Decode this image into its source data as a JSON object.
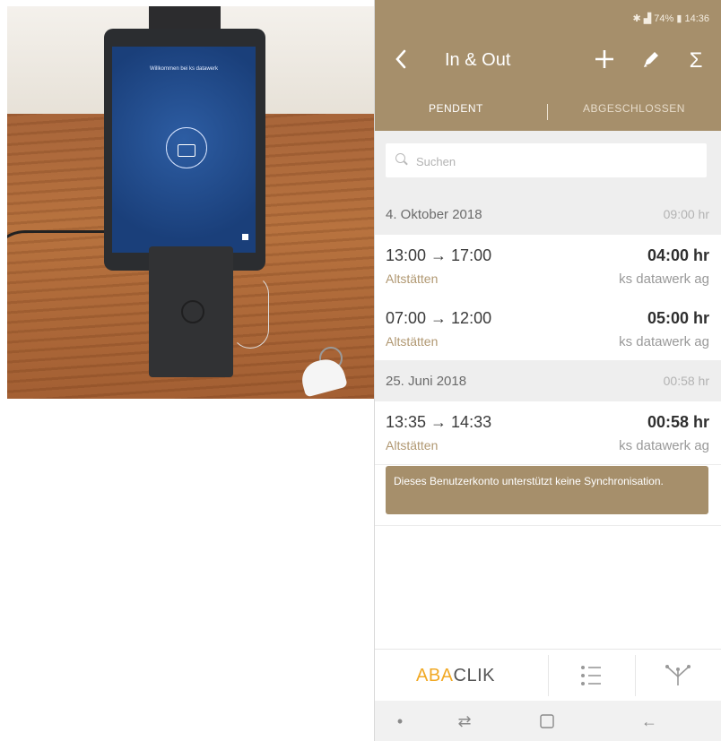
{
  "photo": {
    "screen_greeting": "Willkommen bei ks datawerk"
  },
  "status_bar": {
    "battery": "74%",
    "time": "14:36"
  },
  "app_bar": {
    "back_icon": "back-chevron-icon",
    "title": "In & Out",
    "actions": [
      {
        "name": "add",
        "icon": "plus-icon",
        "glyph": "+"
      },
      {
        "name": "edit",
        "icon": "pencil-icon",
        "glyph": "✎"
      },
      {
        "name": "sum",
        "icon": "sigma-icon",
        "glyph": "Σ"
      }
    ]
  },
  "tabs": [
    {
      "label": "PENDENT",
      "selected": true
    },
    {
      "label": "ABGESCHLOSSEN",
      "selected": false
    }
  ],
  "search": {
    "placeholder": "Suchen"
  },
  "groups": [
    {
      "date": "4. Oktober 2018",
      "total": "09:00 hr",
      "entries": [
        {
          "time": "13:00 → 17:00",
          "duration": "04:00 hr",
          "location": "Altstätten",
          "organization": "ks datawerk ag"
        },
        {
          "time": "07:00 → 12:00",
          "duration": "05:00 hr",
          "location": "Altstätten",
          "organization": "ks datawerk ag"
        }
      ]
    },
    {
      "date": "25. Juni 2018",
      "total": "00:58 hr",
      "entries": [
        {
          "time": "13:35 → 14:33",
          "duration": "00:58 hr",
          "location": "Altstätten",
          "organization": "ks datawerk ag"
        }
      ]
    }
  ],
  "sync_notice": "Dieses Benutzerkonto unterstützt keine Synchronisation.",
  "bottom_nav": {
    "brand_part1": "ABA",
    "brand_part2": "CLIK",
    "list_icon": "list-icon",
    "share_icon": "network-share-icon"
  },
  "system_nav": {
    "icons": [
      "dot-icon",
      "recent-apps-icon",
      "home-icon",
      "back-arrow-icon"
    ]
  },
  "colors": {
    "accent": "#a68f6b",
    "brand_orange": "#f1a925",
    "location_text": "#b19872"
  }
}
